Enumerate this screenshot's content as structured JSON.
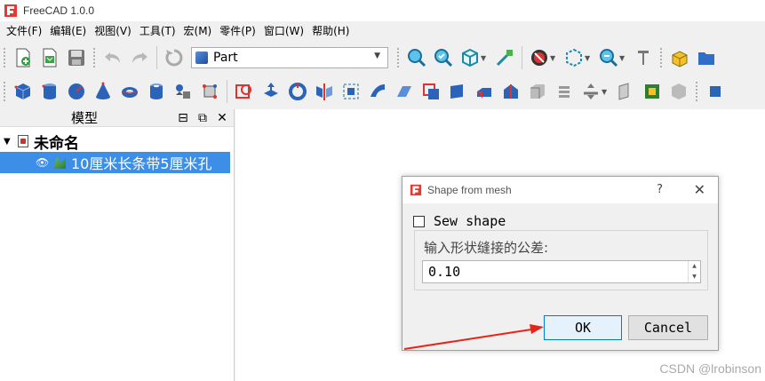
{
  "window": {
    "title": "FreeCAD 1.0.0"
  },
  "menu": [
    "文件(F)",
    "编辑(E)",
    "视图(V)",
    "工具(T)",
    "宏(M)",
    "零件(P)",
    "窗口(W)",
    "帮助(H)"
  ],
  "toolbar": {
    "workbench_selected": "Part",
    "row1_icons": [
      "new-file",
      "open-file",
      "save-file",
      "undo",
      "redo",
      "refresh",
      "fit-all",
      "fit-selection",
      "std-views",
      "measure",
      "draw-style",
      "bounding-box",
      "zoom",
      "measure-tool",
      "part-icon",
      "group-icon"
    ],
    "row2_icons": [
      "cube",
      "cylinder",
      "sphere",
      "cone",
      "torus",
      "tube",
      "primitives",
      "shape-builder",
      "sketch",
      "extrude",
      "revolve",
      "mirror",
      "fillet",
      "chamfer",
      "make-face",
      "ruled-surface",
      "loft",
      "sweep",
      "section",
      "cross-sections",
      "offset",
      "thickness",
      "projection",
      "attachment",
      "color-per-face",
      "boolean"
    ]
  },
  "tree": {
    "panel_title": "模型",
    "document": "未命名",
    "items": [
      {
        "label": "10厘米长条带5厘米孔"
      }
    ]
  },
  "dialog": {
    "title": "Shape from mesh",
    "help": "?",
    "sew_shape_label": "Sew shape",
    "sew_shape_checked": false,
    "tolerance_label": "输入形状缝接的公差:",
    "tolerance_value": "0.10",
    "ok_label": "OK",
    "cancel_label": "Cancel"
  },
  "colors": {
    "selection": "#3d8ee6",
    "annotation_arrow": "#e8241a",
    "ok_border": "#0078d7"
  },
  "watermark": "CSDN @lrobinson"
}
